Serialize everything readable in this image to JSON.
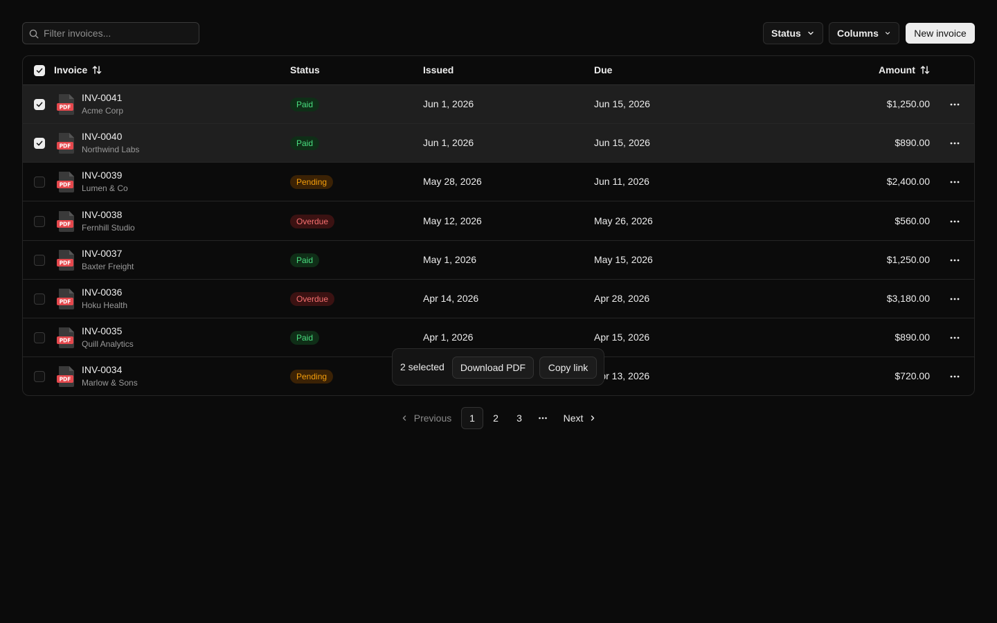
{
  "toolbar": {
    "filter_placeholder": "Filter invoices...",
    "status_label": "Status",
    "columns_label": "Columns",
    "new_invoice_label": "New invoice"
  },
  "table": {
    "columns": [
      "Invoice",
      "Status",
      "Issued",
      "Due",
      "Amount"
    ],
    "rows": [
      {
        "id": "INV-0041",
        "client": "Acme Corp",
        "status": "Paid",
        "issued": "Jun 1, 2026",
        "due": "Jun 15, 2026",
        "amount": "$1,250.00",
        "selected": true
      },
      {
        "id": "INV-0040",
        "client": "Northwind Labs",
        "status": "Paid",
        "issued": "Jun 1, 2026",
        "due": "Jun 15, 2026",
        "amount": "$890.00",
        "selected": true
      },
      {
        "id": "INV-0039",
        "client": "Lumen & Co",
        "status": "Pending",
        "issued": "May 28, 2026",
        "due": "Jun 11, 2026",
        "amount": "$2,400.00",
        "selected": false
      },
      {
        "id": "INV-0038",
        "client": "Fernhill Studio",
        "status": "Overdue",
        "issued": "May 12, 2026",
        "due": "May 26, 2026",
        "amount": "$560.00",
        "selected": false
      },
      {
        "id": "INV-0037",
        "client": "Baxter Freight",
        "status": "Paid",
        "issued": "May 1, 2026",
        "due": "May 15, 2026",
        "amount": "$1,250.00",
        "selected": false
      },
      {
        "id": "INV-0036",
        "client": "Hoku Health",
        "status": "Overdue",
        "issued": "Apr 14, 2026",
        "due": "Apr 28, 2026",
        "amount": "$3,180.00",
        "selected": false
      },
      {
        "id": "INV-0035",
        "client": "Quill Analytics",
        "status": "Paid",
        "issued": "Apr 1, 2026",
        "due": "Apr 15, 2026",
        "amount": "$890.00",
        "selected": false
      },
      {
        "id": "INV-0034",
        "client": "Marlow & Sons",
        "status": "Pending",
        "issued": "",
        "due": "Apr 13, 2026",
        "amount": "$720.00",
        "selected": false
      }
    ],
    "file_badge": "PDF"
  },
  "bulk_bar": {
    "count_label": "2 selected",
    "download_label": "Download PDF",
    "copy_label": "Copy link"
  },
  "pagination": {
    "previous_label": "Previous",
    "pages": [
      "1",
      "2",
      "3"
    ],
    "active_page": "1",
    "next_label": "Next"
  },
  "colors": {
    "paid": "#4ade80",
    "pending": "#f59e0b",
    "overdue": "#f87171",
    "pdf": "#e5484d"
  }
}
